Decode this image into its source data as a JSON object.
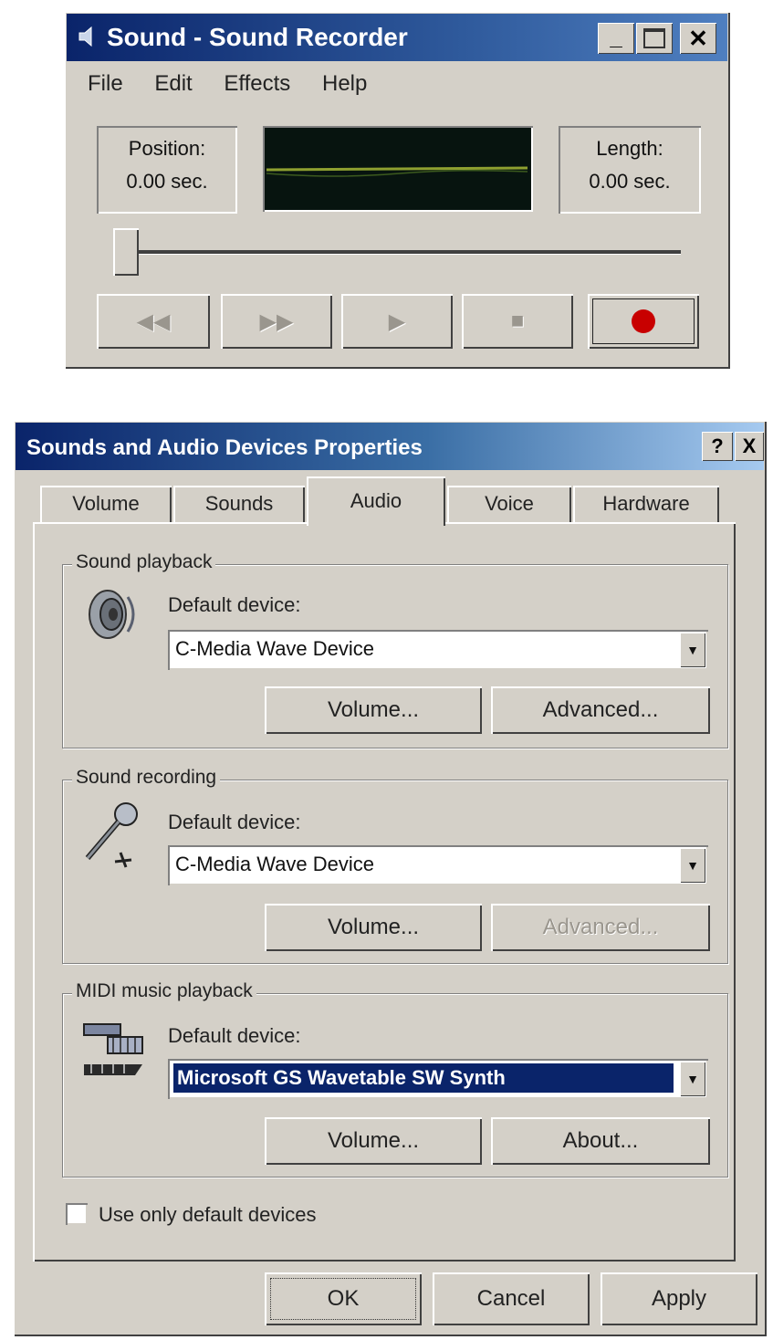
{
  "recorder": {
    "title": "Sound - Sound Recorder",
    "menu": [
      "File",
      "Edit",
      "Effects",
      "Help"
    ],
    "position_label": "Position:",
    "position_value": "0.00 sec.",
    "length_label": "Length:",
    "length_value": "0.00 sec.",
    "slider_position": 0,
    "controls": {
      "rewind_icon": "seek-to-start-icon",
      "forward_icon": "seek-to-end-icon",
      "play_icon": "play-icon",
      "stop_icon": "stop-icon",
      "record_icon": "record-icon"
    },
    "waveform_color": "#8ea030",
    "record_color": "#c80000"
  },
  "properties": {
    "title": "Sounds and Audio Devices Properties",
    "help_button": "?",
    "close_button": "X",
    "tabs": [
      "Volume",
      "Sounds",
      "Audio",
      "Voice",
      "Hardware"
    ],
    "active_tab": "Audio",
    "playback": {
      "legend": "Sound playback",
      "device_label": "Default device:",
      "device": "C-Media Wave Device",
      "volume_button": "Volume...",
      "advanced_button": "Advanced..."
    },
    "recording": {
      "legend": "Sound recording",
      "device_label": "Default device:",
      "device": "C-Media Wave Device",
      "volume_button": "Volume...",
      "advanced_button": "Advanced..."
    },
    "midi": {
      "legend": "MIDI music playback",
      "device_label": "Default device:",
      "device": "Microsoft GS Wavetable SW Synth",
      "volume_button": "Volume...",
      "about_button": "About..."
    },
    "use_default_only": "Use only default devices",
    "use_default_only_checked": false,
    "ok": "OK",
    "cancel": "Cancel",
    "apply": "Apply"
  }
}
